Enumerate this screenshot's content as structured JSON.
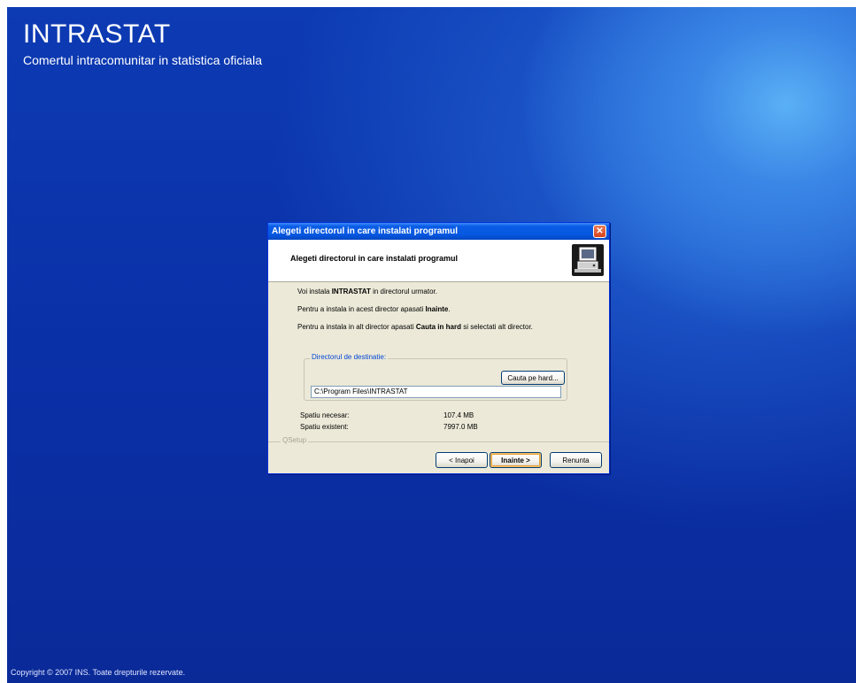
{
  "background": {
    "title": "INTRASTAT",
    "subtitle": "Comertul intracomunitar in statistica oficiala",
    "copyright": "Copyright © 2007 INS. Toate drepturile rezervate."
  },
  "dialog": {
    "window_title": "Alegeti directorul in care instalati programul",
    "close_glyph": "✕",
    "header_title": "Alegeti directorul in care instalati programul",
    "header_icon": "computer-setup-icon",
    "line1": {
      "pre": "Voi instala ",
      "bold": "INTRASTAT",
      "post": " in directorul urmator."
    },
    "line2": {
      "pre": "Pentru a instala in acest director apasati ",
      "bold": "Inainte",
      "post": "."
    },
    "line3": {
      "pre": "Pentru a instala in alt director apasati ",
      "bold": "Cauta in hard",
      "post": " si selectati alt director."
    },
    "group_label": "Directorul de destinatie:",
    "browse_button": "Cauta pe hard...",
    "path_value": "C:\\Program Files\\INTRASTAT",
    "space_required_label": "Spatiu necesar:",
    "space_required_value": "107.4 MB",
    "space_available_label": "Spatiu existent:",
    "space_available_value": "7997.0 MB",
    "branding": "QSetup",
    "back_button": "< Inapoi",
    "next_button": "Inainte >",
    "cancel_button": "Renunta"
  },
  "colors": {
    "desktop_blue": "#0a2fa6",
    "titlebar_blue": "#0758e0",
    "dialog_face": "#ece9d8",
    "group_label": "#0046d5"
  }
}
